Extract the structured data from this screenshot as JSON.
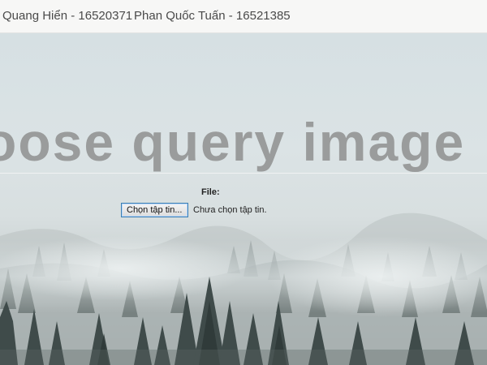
{
  "header": {
    "author_1": "Quang Hiển - 16520371",
    "author_2": "Phan Quốc Tuấn - 16521385"
  },
  "hero": {
    "title": "oose query image"
  },
  "form": {
    "file_label": "File:",
    "choose_button_label": "Chọn tập tin...",
    "no_file_status": "Chưa chọn tập tin."
  },
  "colors": {
    "title_text": "#9a9c9c",
    "button_border": "#3c7fb1",
    "fog_sky": "#d6e0e3",
    "tree_dark": "#3f4b4a"
  }
}
